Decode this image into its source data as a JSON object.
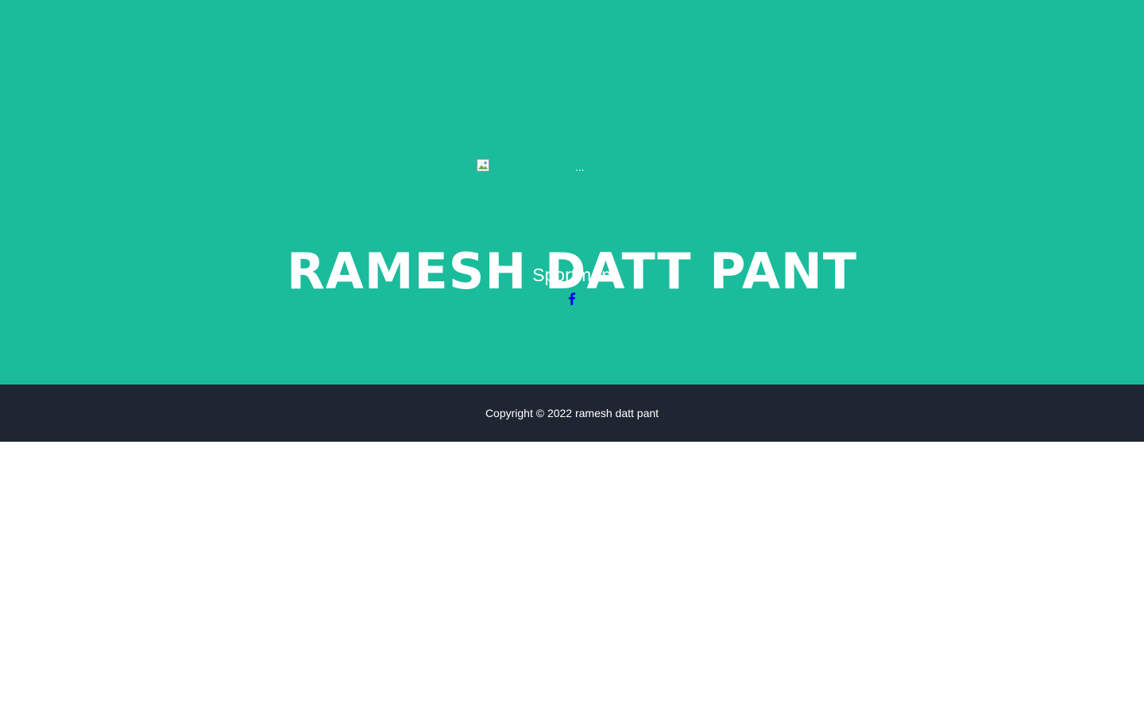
{
  "profile": {
    "image_alt": "...",
    "name": "RAMESH DATT PANT",
    "title": "Sportman"
  },
  "social": {
    "facebook_icon": "facebook-icon",
    "link_color": "#0000ee"
  },
  "footer": {
    "copyright": "Copyright © 2022 ramesh datt pant"
  },
  "colors": {
    "hero_background": "#1abc9c",
    "footer_background": "#1e2632",
    "text": "#ffffff"
  }
}
